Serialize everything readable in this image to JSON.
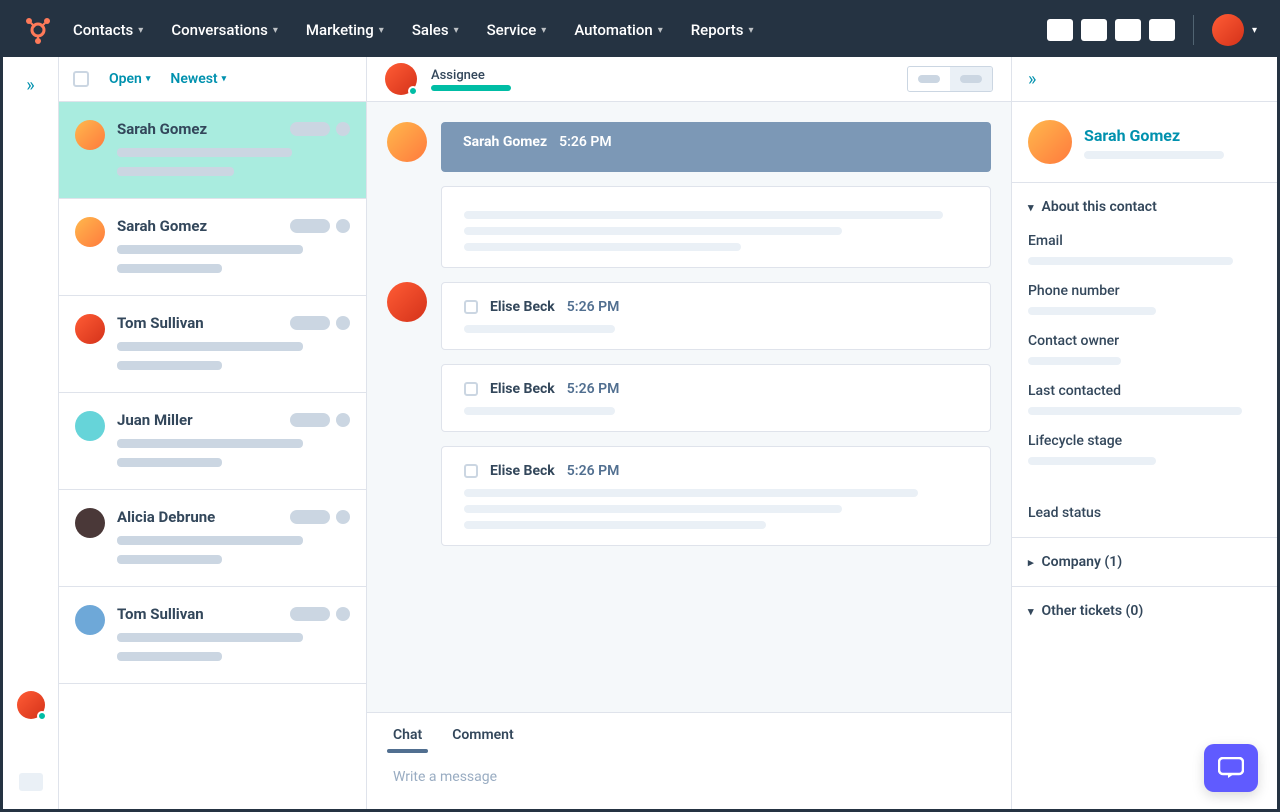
{
  "nav": {
    "items": [
      "Contacts",
      "Conversations",
      "Marketing",
      "Sales",
      "Service",
      "Automation",
      "Reports"
    ]
  },
  "filters": {
    "status": "Open",
    "sort": "Newest"
  },
  "conversations": [
    {
      "name": "Sarah Gomez",
      "active": true,
      "avatar": "av-orange"
    },
    {
      "name": "Sarah Gomez",
      "active": false,
      "avatar": "av-orange"
    },
    {
      "name": "Tom Sullivan",
      "active": false,
      "avatar": "av-red"
    },
    {
      "name": "Juan Miller",
      "active": false,
      "avatar": "av-teal"
    },
    {
      "name": "Alicia Debrune",
      "active": false,
      "avatar": "av-dark"
    },
    {
      "name": "Tom Sullivan",
      "active": false,
      "avatar": "av-blue"
    }
  ],
  "thread": {
    "assignee_label": "Assignee",
    "messages": [
      {
        "from": "Sarah Gomez",
        "time": "5:26 PM",
        "header": true,
        "lines": 3,
        "avatar": "av-orange"
      },
      {
        "from": "Elise Beck",
        "time": "5:26 PM",
        "header": false,
        "lines": 1,
        "avatar": "av-red"
      },
      {
        "from": "Elise Beck",
        "time": "5:26 PM",
        "header": false,
        "lines": 1
      },
      {
        "from": "Elise Beck",
        "time": "5:26 PM",
        "header": false,
        "lines": 3
      }
    ]
  },
  "compose": {
    "tabs": [
      "Chat",
      "Comment"
    ],
    "placeholder": "Write a message"
  },
  "contact": {
    "name": "Sarah Gomez",
    "sections": {
      "about": "About this contact",
      "company": "Company (1)",
      "tickets": "Other tickets (0)"
    },
    "fields": [
      "Email",
      "Phone number",
      "Contact owner",
      "Last contacted",
      "Lifecycle stage",
      "Lead status"
    ]
  }
}
